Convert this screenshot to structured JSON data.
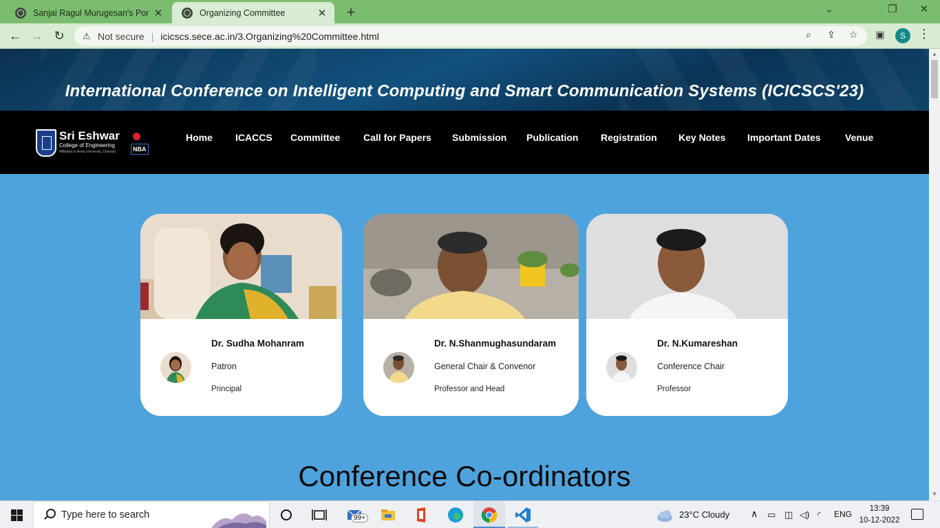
{
  "browser": {
    "tabs": [
      {
        "title": "Sanjai Ragul Murugesan's Portfolio",
        "active": false
      },
      {
        "title": "Organizing Committee",
        "active": true
      }
    ],
    "security_label": "Not secure",
    "url": "icicscs.sece.ac.in/3.Organizing%20Committee.html",
    "profile_initial": "S"
  },
  "banner": {
    "title": "International Conference on Intelligent Computing and Smart Communication Systems (ICICSCS'23)"
  },
  "logo": {
    "name": "Sri Eshwar",
    "subtitle": "College of Engineering",
    "tagline": "An Autonomous Institution",
    "affiliation": "Affiliated to Anna University, Chennai",
    "accreditation": "NBA"
  },
  "nav": {
    "items": [
      "Home",
      "ICACCS",
      "Committee",
      "Call for Papers",
      "Submission",
      "Publication",
      "Registration",
      "Key Notes",
      "Important Dates",
      "Venue"
    ]
  },
  "members": [
    {
      "name": "Dr. Sudha Mohanram",
      "role": "Patron",
      "designation": "Principal"
    },
    {
      "name": "Dr. N.Shanmughasundaram",
      "role": "General Chair & Convenor",
      "designation": "Professor and Head"
    },
    {
      "name": "Dr. N.Kumareshan",
      "role": "Conference Chair",
      "designation": "Professor"
    }
  ],
  "section": {
    "heading": "Conference Co-ordinators"
  },
  "taskbar": {
    "search_placeholder": "Type here to search",
    "mail_badge": "99+",
    "weather": "23°C  Cloudy",
    "language": "ENG",
    "time": "13:39",
    "date": "10-12-2022"
  },
  "colors": {
    "page_background": "#4ea3dc",
    "navbar": "#000000",
    "tab_strip": "#7bbd6f",
    "toolbar": "#d7ecd2"
  }
}
